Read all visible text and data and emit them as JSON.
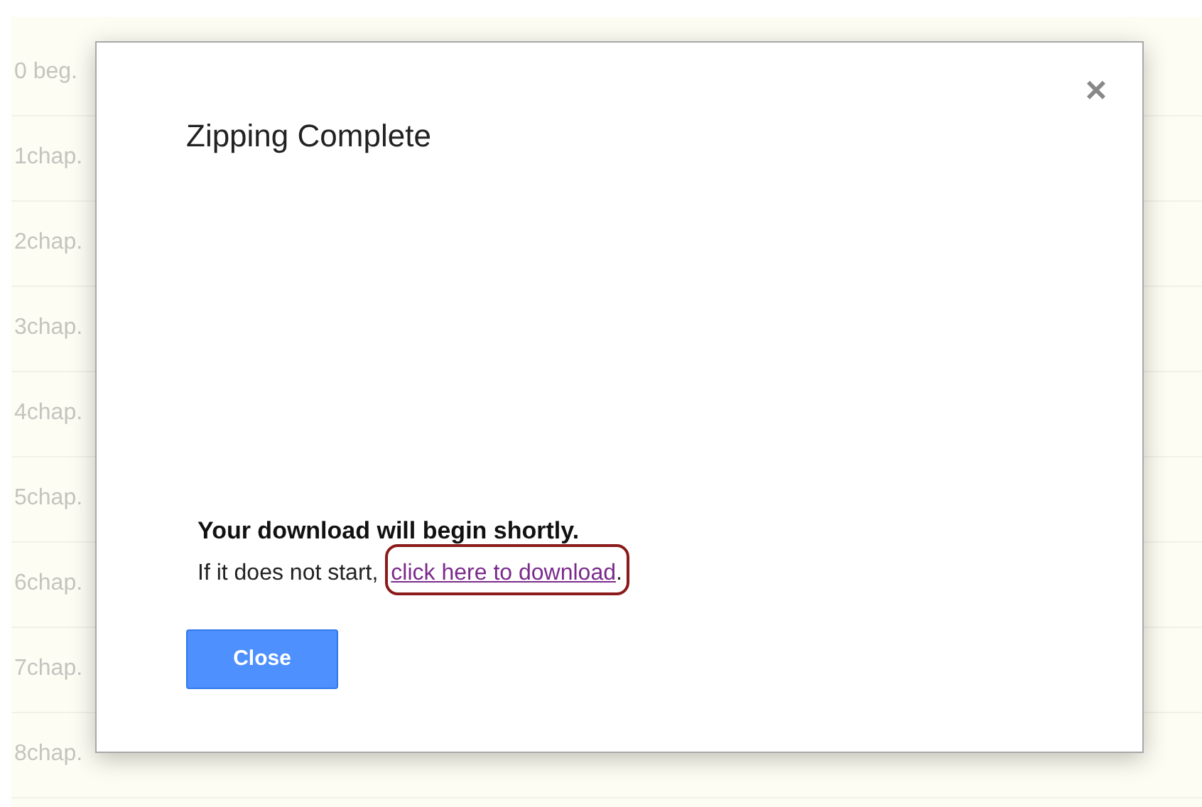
{
  "background_list": {
    "items": [
      "0 beg.",
      "1chap.",
      "2chap.",
      "3chap.",
      "4chap.",
      "5chap.",
      "6chap.",
      "7chap.",
      "8chap."
    ]
  },
  "dialog": {
    "title": "Zipping Complete",
    "close_icon": "×",
    "heading": "Your download will begin shortly.",
    "message": "If it does not start,",
    "link": "click here to download",
    "link_suffix": ".",
    "button": "Close"
  }
}
